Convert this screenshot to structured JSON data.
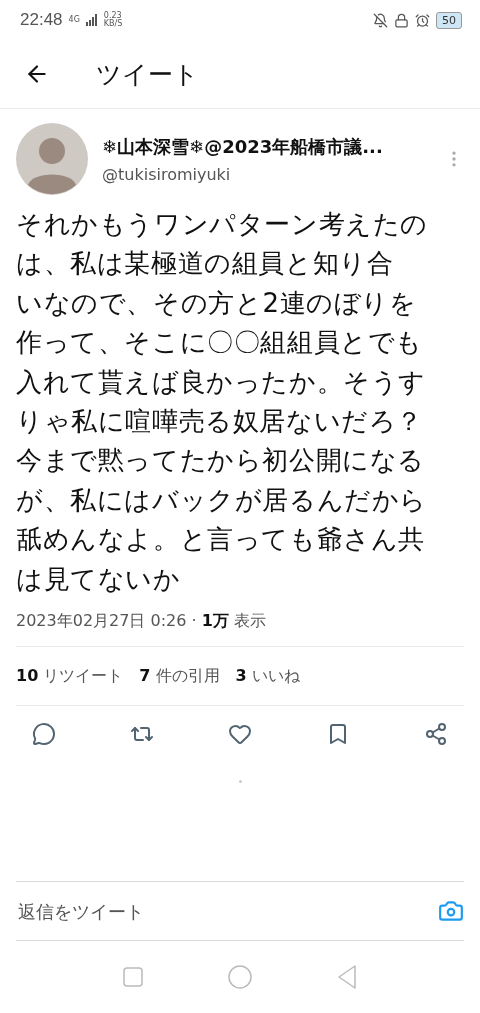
{
  "status_bar": {
    "time": "22:48",
    "network": "4G",
    "speed_value": "0.23",
    "speed_unit": "KB/S",
    "battery": "50"
  },
  "header": {
    "title": "ツイート"
  },
  "author": {
    "name": "❄山本深雪❄@2023年船橋市議...",
    "handle": "@tukisiromiyuki"
  },
  "tweet": {
    "lines": [
      "それかもうワンパターン考えたの",
      "は、私は某極道の組員と知り合",
      "いなので、その方と2連のぼりを",
      "作って、そこに〇〇組組員とでも",
      "入れて貰えば良かったか。そうす",
      "りゃ私に喧嘩売る奴居ないだろ？",
      "今まで黙ってたから初公開になる",
      "が、私にはバックが居るんだから",
      "舐めんなよ。と言っても爺さん共",
      "は見てないか"
    ],
    "timestamp": "2023年02月27日 0:26 · **1万** 表示"
  },
  "stats": [
    {
      "count": "10",
      "label": "リツイート"
    },
    {
      "count": "7",
      "label": "件の引用"
    },
    {
      "count": "3",
      "label": "いいね"
    }
  ],
  "actions": [
    {
      "kind": "reply"
    },
    {
      "kind": "retweet"
    },
    {
      "kind": "like"
    },
    {
      "kind": "bookmark"
    },
    {
      "kind": "share"
    }
  ],
  "reply_bar": {
    "placeholder": "返信をツイート"
  }
}
